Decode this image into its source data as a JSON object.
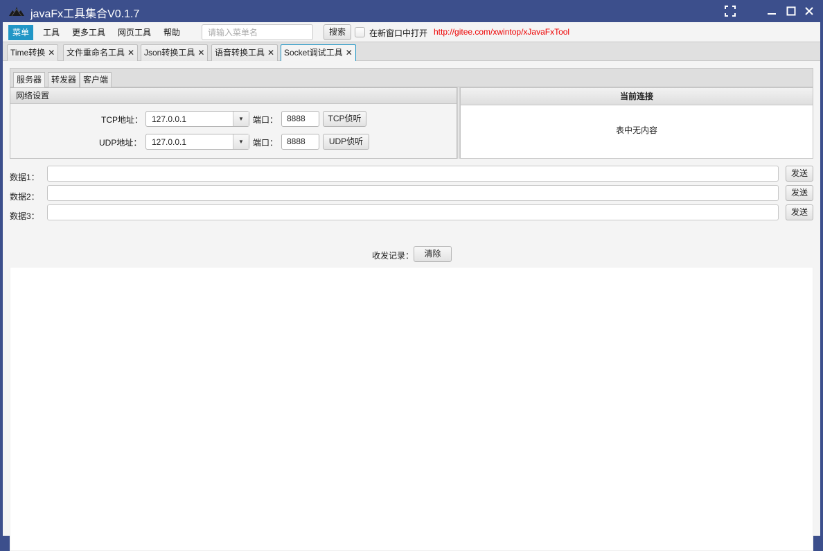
{
  "window": {
    "title": "javaFx工具集合V0.1.7",
    "accent": "#3c4f8c"
  },
  "menubar": {
    "items": [
      "菜单",
      "工具",
      "更多工具",
      "网页工具",
      "帮助"
    ],
    "search_placeholder": "请输入菜单名",
    "search_button": "搜索",
    "new_window_label": "在新窗口中打开",
    "link": "http://gitee.com/xwintop/xJavaFxTool"
  },
  "tabs": [
    {
      "label": "Time转换",
      "close": "✕"
    },
    {
      "label": "文件重命名工具",
      "close": "✕"
    },
    {
      "label": "Json转换工具",
      "close": "✕"
    },
    {
      "label": "语音转换工具",
      "close": "✕"
    },
    {
      "label": "Socket调试工具",
      "close": "✕"
    }
  ],
  "subtabs": [
    "服务器",
    "转发器",
    "客户端"
  ],
  "network": {
    "header": "网络设置",
    "tcp_label": "TCP地址：",
    "tcp_address": "127.0.0.1",
    "tcp_port_label": "端口：",
    "tcp_port": "8888",
    "tcp_button": "TCP侦听",
    "udp_label": "UDP地址：",
    "udp_address": "127.0.0.1",
    "udp_port_label": "端口：",
    "udp_port": "8888",
    "udp_button": "UDP侦听"
  },
  "connections": {
    "header": "当前连接",
    "empty": "表中无内容"
  },
  "data_rows": [
    {
      "label": "数据1：",
      "value": "",
      "button": "发送"
    },
    {
      "label": "数据2：",
      "value": "",
      "button": "发送"
    },
    {
      "label": "数据3：",
      "value": "",
      "button": "发送"
    }
  ],
  "log": {
    "label": "收发记录：",
    "clear_button": "清除"
  }
}
